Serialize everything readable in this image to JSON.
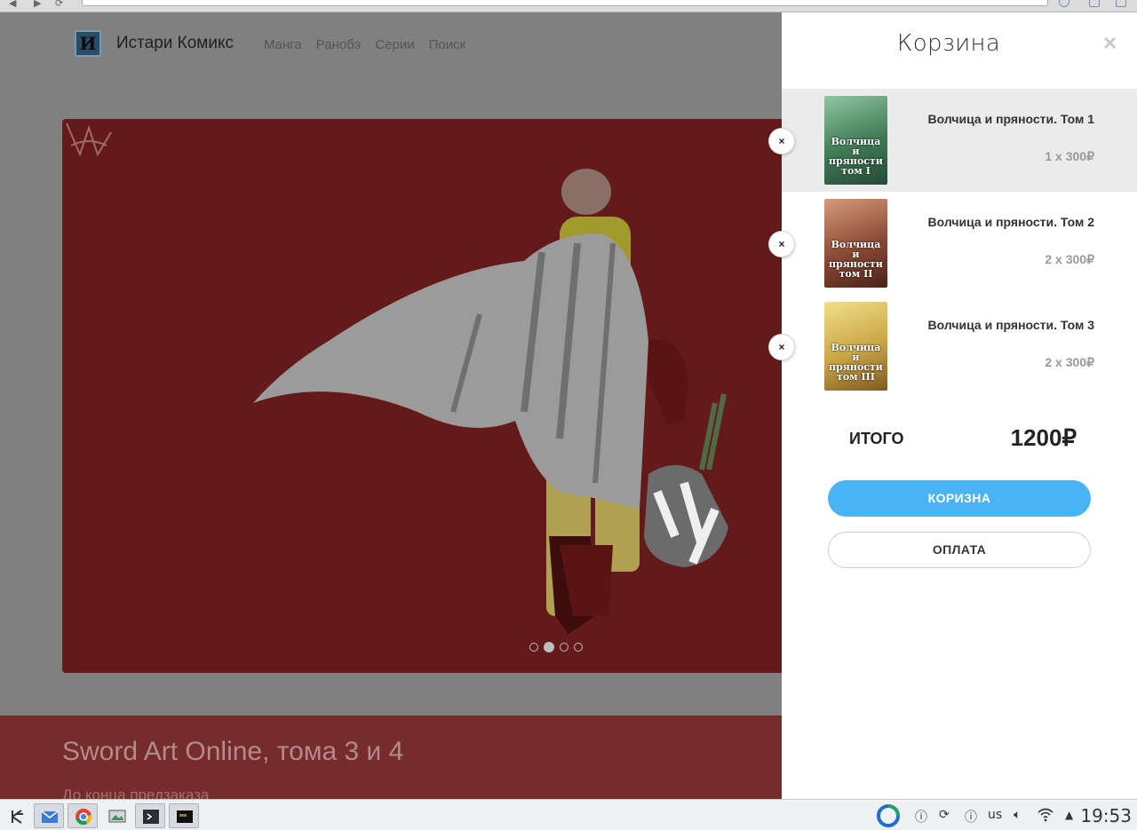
{
  "site": {
    "logo_letter": "И",
    "name": "Истари Комикс",
    "nav": [
      "Манга",
      "Ранобэ",
      "Серии",
      "Поиск"
    ]
  },
  "promo": {
    "title": "Sword Art Online, тома 3 и 4",
    "subtitle": "До конца предзаказа",
    "carousel_active_index": 1,
    "carousel_count": 4
  },
  "cart": {
    "title": "Корзина",
    "close_icon": "×",
    "remove_icon": "×",
    "items": [
      {
        "title": "Волчица и пряности. Том 1",
        "qty": "1 x 300₽",
        "cover_text": "Волчица и пряности том I",
        "cover_color": "#3f7a55"
      },
      {
        "title": "Волчица и пряности. Том 2",
        "qty": "2 x 300₽",
        "cover_text": "Волчица и пряности том II",
        "cover_color": "#8b4a36"
      },
      {
        "title": "Волчица и пряности. Том 3",
        "qty": "2 x 300₽",
        "cover_text": "Волчица и пряности том III",
        "cover_color": "#c9a545"
      }
    ],
    "total_label": "ИТОГО",
    "total_value": "1200₽",
    "cart_button": "КОРИЗНА",
    "pay_button": "ОПЛАТА"
  },
  "taskbar": {
    "keyboard_layout": "us",
    "clock": "19:53"
  },
  "colors": {
    "accent": "#4ab3f4",
    "hero_background": "#641a1a",
    "promo_band": "#762c2c"
  }
}
